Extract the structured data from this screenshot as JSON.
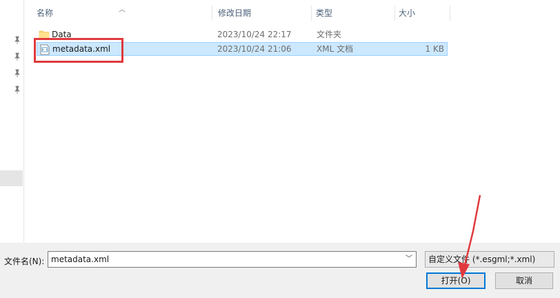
{
  "columns": {
    "name": "名称",
    "modified": "修改日期",
    "type": "类型",
    "size": "大小"
  },
  "rows": [
    {
      "name": "Data",
      "modified": "2023/10/24 22:17",
      "type": "文件夹",
      "size": "",
      "icon": "folder-icon"
    },
    {
      "name": "metadata.xml",
      "modified": "2023/10/24 21:06",
      "type": "XML 文档",
      "size": "1 KB",
      "icon": "xml-file-icon"
    }
  ],
  "footer": {
    "filename_label": "文件名(N):",
    "filename_value": "metadata.xml",
    "filter_value": "自定义文件 (*.esgml;*.xml)",
    "open_label": "打开(O)",
    "cancel_label": "取消"
  },
  "colors": {
    "selection_bg": "#cce8ff",
    "selection_border": "#99d1ff",
    "annotation_red": "#e0393e",
    "focus_blue": "#0078d7"
  }
}
